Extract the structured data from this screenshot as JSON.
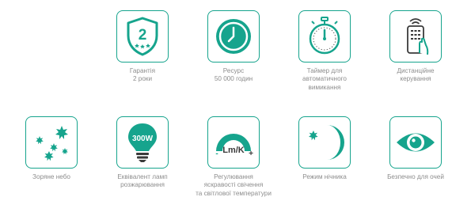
{
  "accent_color": "#16a48d",
  "label_color": "#8d8d8d",
  "features": [
    {
      "id": "warranty",
      "icon": "warranty-shield-icon",
      "icon_text": "2",
      "label": [
        "Гарантія",
        "2 роки"
      ]
    },
    {
      "id": "lifetime",
      "icon": "clock-icon",
      "label": [
        "Ресурс",
        "50 000 годин"
      ]
    },
    {
      "id": "timer",
      "icon": "stopwatch-icon",
      "label": [
        "Таймер для",
        "автоматичного",
        "вимикання"
      ]
    },
    {
      "id": "remote",
      "icon": "remote-control-icon",
      "label": [
        "Дистанційне",
        "керування"
      ]
    },
    {
      "id": "starry-sky",
      "icon": "stars-icon",
      "label": [
        "Зоряне небо"
      ]
    },
    {
      "id": "equivalent",
      "icon": "bulb-icon",
      "icon_text": "300W",
      "label": [
        "Еквівалент ламп",
        "розжарювання"
      ]
    },
    {
      "id": "adjustment",
      "icon": "brightness-dial-icon",
      "icon_text": "Lm/K",
      "icon_minus": "-",
      "icon_plus": "+",
      "label": [
        "Регулювання",
        "яскравості свічення",
        "та світлової температури"
      ]
    },
    {
      "id": "night-mode",
      "icon": "moon-icon",
      "label": [
        "Режим нічника"
      ]
    },
    {
      "id": "eye-safe",
      "icon": "eye-icon",
      "label": [
        "Безпечно для очей"
      ]
    }
  ]
}
